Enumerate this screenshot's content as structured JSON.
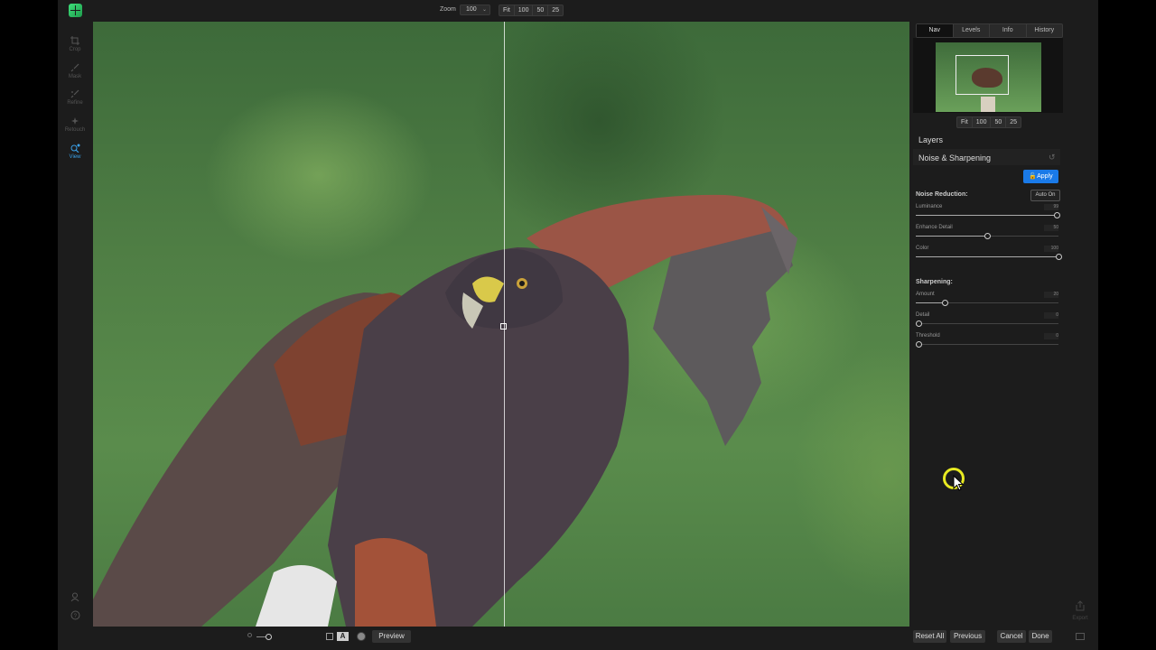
{
  "topbar": {
    "zoom_label": "Zoom",
    "zoom_value": "100",
    "zoom_presets": [
      "Fit",
      "100",
      "50",
      "25"
    ]
  },
  "tools": [
    {
      "label": "Crop",
      "icon": "crop-icon",
      "active": false
    },
    {
      "label": "Mask",
      "icon": "brush-icon",
      "active": false
    },
    {
      "label": "Refine",
      "icon": "refine-brush-icon",
      "active": false
    },
    {
      "label": "Retouch",
      "icon": "retouch-icon",
      "active": false
    },
    {
      "label": "View",
      "icon": "view-icon",
      "active": true
    }
  ],
  "panel": {
    "tabs": [
      "Nav",
      "Levels",
      "Info",
      "History"
    ],
    "active_tab": "Nav",
    "nav_zoom_presets": [
      "Fit",
      "100",
      "50",
      "25"
    ],
    "layers_label": "Layers",
    "section_title": "Noise & Sharpening",
    "apply_label": "Apply",
    "noise_reduction": {
      "title": "Noise Reduction:",
      "auto_label": "Auto On",
      "sliders": [
        {
          "label": "Luminance",
          "value": "99",
          "fraction": 0.99
        },
        {
          "label": "Enhance Detail",
          "value": "50",
          "fraction": 0.5
        },
        {
          "label": "Color",
          "value": "100",
          "fraction": 1.0
        }
      ]
    },
    "sharpening": {
      "title": "Sharpening:",
      "sliders": [
        {
          "label": "Amount",
          "value": "20",
          "fraction": 0.2
        },
        {
          "label": "Detail",
          "value": "0",
          "fraction": 0.0
        },
        {
          "label": "Threshold",
          "value": "0",
          "fraction": 0.0
        }
      ]
    }
  },
  "bottombar": {
    "preview_label": "Preview",
    "reset_all_label": "Reset All",
    "previous_label": "Previous",
    "cancel_label": "Cancel",
    "done_label": "Done",
    "export_label": "Export"
  },
  "colors": {
    "accent": "#1a7ae8",
    "active_tool": "#3aa0e8",
    "cursor_highlight": "#e8ea22"
  }
}
